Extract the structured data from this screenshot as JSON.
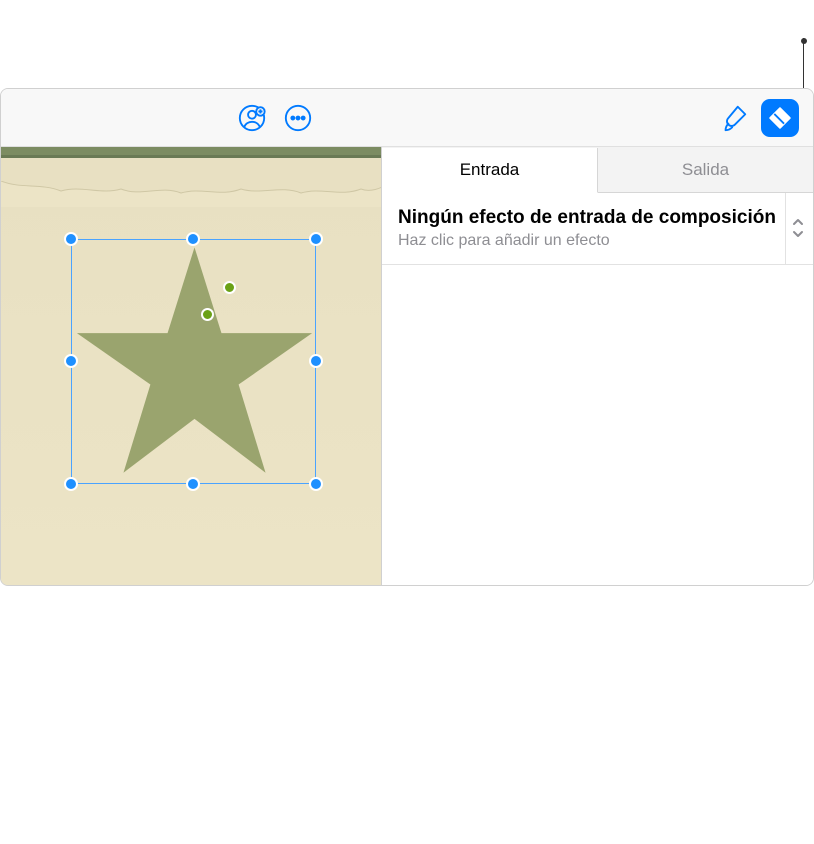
{
  "toolbar": {
    "collaborate_icon": "collaborate-icon",
    "more_icon": "ellipsis-icon",
    "format_icon": "paintbrush-icon",
    "animate_icon": "animate-diamond-icon"
  },
  "canvas": {
    "selected_shape": "star"
  },
  "tabs": {
    "entrada": "Entrada",
    "salida": "Salida",
    "active": "entrada"
  },
  "effect_panel": {
    "title": "Ningún efecto de entrada de composición",
    "subtitle": "Haz clic para añadir un efecto"
  },
  "colors": {
    "accent": "#007aff",
    "star_fill": "#9aa46e"
  }
}
